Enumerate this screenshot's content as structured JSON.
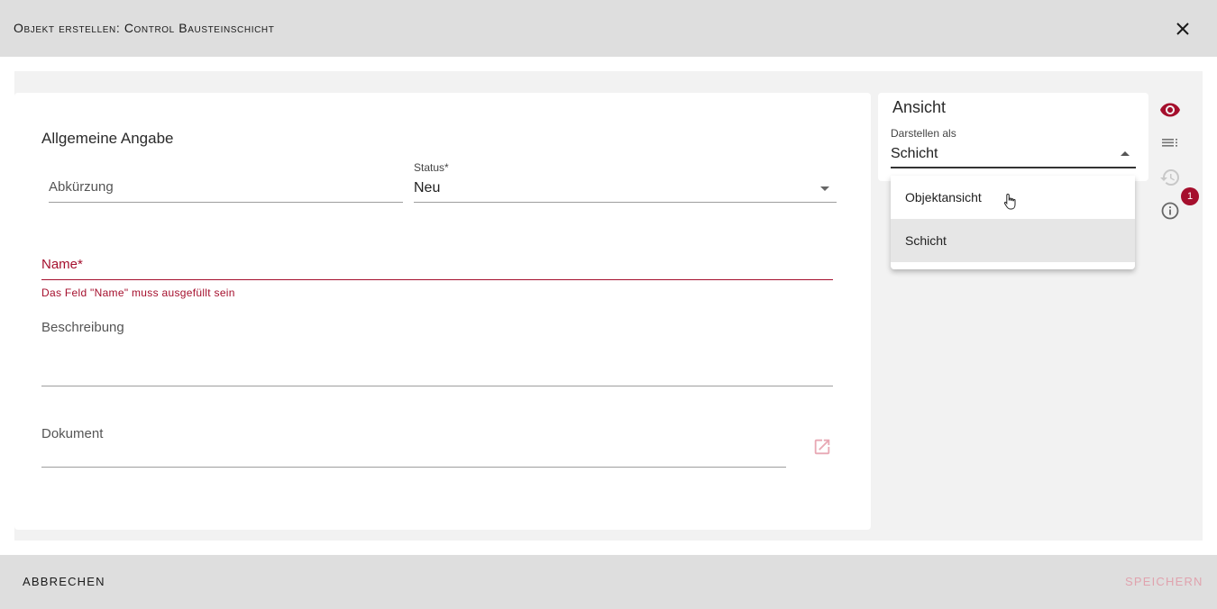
{
  "dialog": {
    "title": "Objekt erstellen: Control Bausteinschicht"
  },
  "form": {
    "section_title": "Allgemeine Angabe",
    "abkuerzung": {
      "label": "Abkürzung",
      "value": ""
    },
    "status": {
      "label": "Status*",
      "value": "Neu"
    },
    "name": {
      "label": "Name*",
      "error": "Das Feld \"Name\" muss ausgefüllt sein"
    },
    "beschreibung": {
      "label": "Beschreibung"
    },
    "dokument": {
      "label": "Dokument"
    }
  },
  "view": {
    "title": "Ansicht",
    "display_label": "Darstellen als",
    "display_value": "Schicht",
    "options": [
      {
        "label": "Objektansicht",
        "selected": false
      },
      {
        "label": "Schicht",
        "selected": true
      }
    ]
  },
  "sidebar": {
    "icons": [
      "eye-icon",
      "list-icon",
      "history-icon",
      "info-icon"
    ],
    "badge_count": "1"
  },
  "footer": {
    "cancel_label": "ABBRECHEN",
    "save_label": "SPEICHERN"
  },
  "colors": {
    "accent": "#a50f2d",
    "header_bg": "#dedede",
    "content_bg": "#f2f2f2",
    "disabled_text": "#e0a3ae"
  }
}
